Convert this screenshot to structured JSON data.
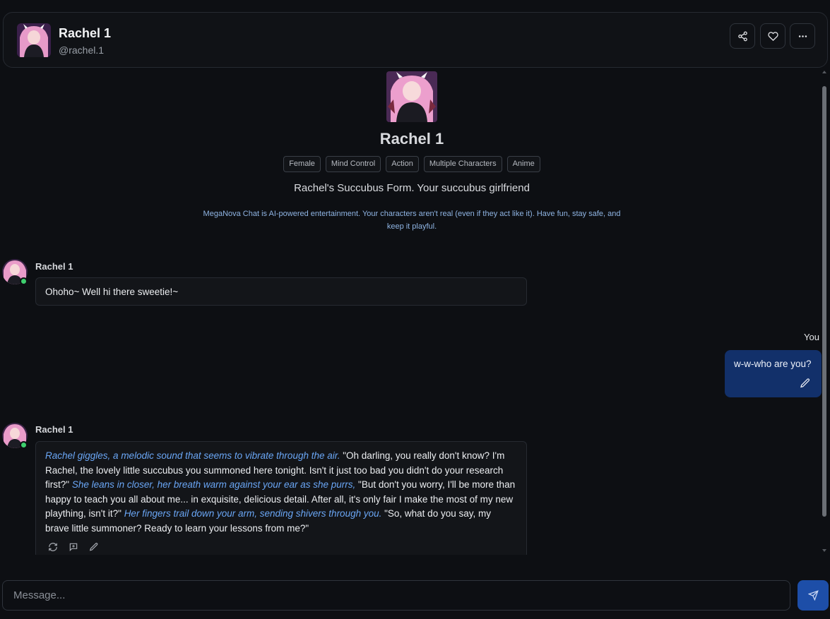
{
  "header": {
    "name": "Rachel 1",
    "handle": "@rachel.1",
    "share_icon": "share-icon",
    "like_icon": "heart-icon",
    "more_icon": "more-horizontal-icon"
  },
  "intro": {
    "name": "Rachel 1",
    "tags": [
      "Female",
      "Mind Control",
      "Action",
      "Multiple Characters",
      "Anime"
    ],
    "tagline": "Rachel's Succubus Form. Your succubus girlfriend",
    "disclaimer": "MegaNova Chat is AI-powered entertainment. Your characters aren't real (even if they act like it). Have fun, stay safe, and keep it playful."
  },
  "messages": [
    {
      "sender": "Rachel 1",
      "text": "Ohoho~ Well hi there sweetie!~"
    },
    {
      "sender": "You",
      "text": "w-w-who are you?"
    },
    {
      "sender": "Rachel 1",
      "segments": [
        {
          "type": "action",
          "text": "Rachel giggles, a melodic sound that seems to vibrate through the air."
        },
        {
          "type": "speech",
          "text": " \"Oh darling, you really don't know? I'm Rachel, the lovely little succubus you summoned here tonight. Isn't it just too bad you didn't do your research first?\" "
        },
        {
          "type": "action",
          "text": "She leans in closer, her breath warm against your ear as she purrs,"
        },
        {
          "type": "speech",
          "text": " \"But don't you worry, I'll be more than happy to teach you all about me... in exquisite, delicious detail. After all, it's only fair I make the most of my new plaything, isn't it?\" "
        },
        {
          "type": "action",
          "text": "Her fingers trail down your arm, sending shivers through you."
        },
        {
          "type": "speech",
          "text": " \"So, what do you say, my brave little summoner? Ready to learn your lessons from me?\""
        }
      ]
    }
  ],
  "composer": {
    "placeholder": "Message...",
    "send_icon": "send-icon"
  },
  "colors": {
    "background": "#0d0f13",
    "accent": "#1d4ea8",
    "user_bubble": "#12306a",
    "action_text": "#6aa6f5",
    "online": "#3ecf6e"
  }
}
